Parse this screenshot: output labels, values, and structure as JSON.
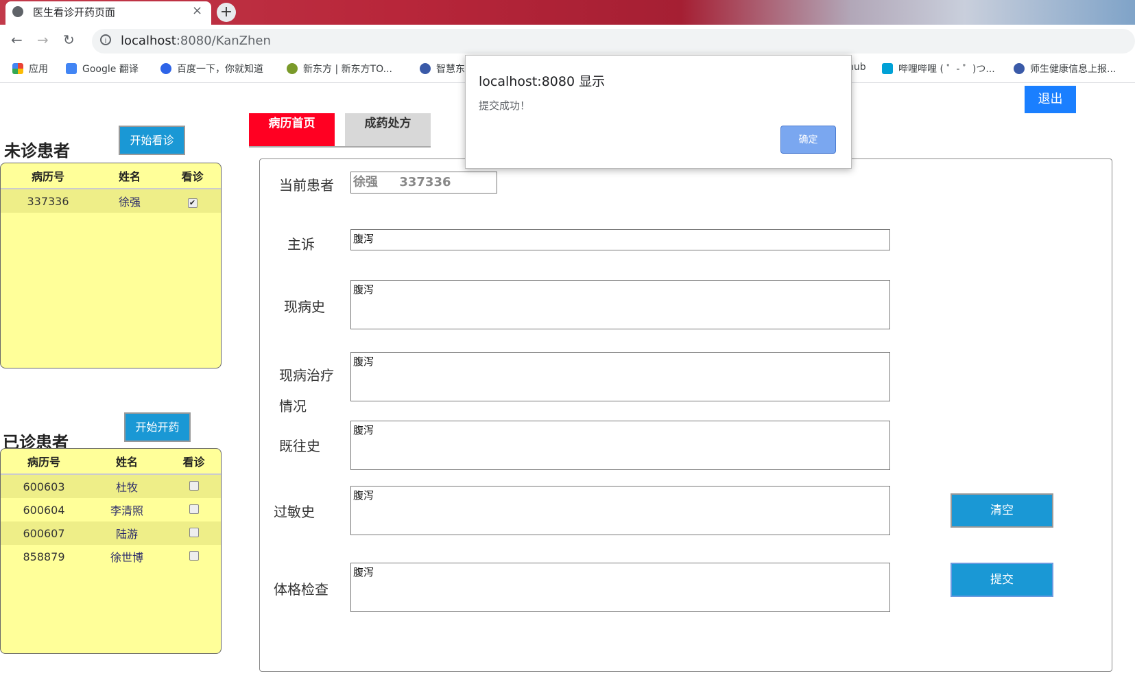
{
  "browser": {
    "tab_title": "医生看诊开药页面",
    "close_glyph": "×",
    "new_tab_glyph": "+",
    "url_host": "localhost",
    "url_path": ":8080/KanZhen",
    "bookmarks": [
      {
        "label": "应用"
      },
      {
        "label": "Google 翻译"
      },
      {
        "label": "百度一下，你就知道"
      },
      {
        "label": "新东方 | 新东方TO..."
      },
      {
        "label": "智慧东"
      },
      {
        "label": "hub"
      },
      {
        "label": "哔哩哔哩 ( ゜- ゜)つ..."
      },
      {
        "label": "师生健康信息上报..."
      }
    ]
  },
  "logout_label": "退出",
  "waiting": {
    "title": "未诊患者",
    "button": "开始看诊",
    "headers": [
      "病历号",
      "姓名",
      "看诊"
    ],
    "rows": [
      {
        "id": "337336",
        "name": "徐强",
        "checked": true
      }
    ]
  },
  "done": {
    "title": "已诊患者",
    "button": "开始开药",
    "headers": [
      "病历号",
      "姓名",
      "看诊"
    ],
    "rows": [
      {
        "id": "600603",
        "name": "杜牧",
        "checked": false
      },
      {
        "id": "600604",
        "name": "李清照",
        "checked": false
      },
      {
        "id": "600607",
        "name": "陆游",
        "checked": false
      },
      {
        "id": "858879",
        "name": "徐世博",
        "checked": false
      }
    ]
  },
  "tabs": [
    {
      "label": "病历首页",
      "active": true
    },
    {
      "label": "成药处方",
      "active": false
    }
  ],
  "form": {
    "current_patient_label": "当前患者",
    "current_patient_name": "徐强",
    "current_patient_id": "337336",
    "chief_complaint_label": "主诉",
    "chief_complaint_value": "腹泻",
    "present_history_label": "现病史",
    "present_history_value": "腹泻",
    "treatment_label_1": "现病治疗",
    "treatment_label_2": "情况",
    "treatment_value": "腹泻",
    "past_history_label": "既往史",
    "past_history_value": "腹泻",
    "allergy_label": "过敏史",
    "allergy_value": "腹泻",
    "physical_exam_label": "体格检查",
    "physical_exam_value": "腹泻",
    "clear_button": "清空",
    "submit_button": "提交"
  },
  "dialog": {
    "title": "localhost:8080 显示",
    "message": "提交成功！",
    "ok_button": "确定"
  },
  "colors": {
    "accent_blue": "#1a98d5",
    "tab_active": "#ff0022",
    "panel_yellow": "#ffff99",
    "logout_blue": "#1a7fff",
    "dialog_ok": "#7aa7f0"
  }
}
